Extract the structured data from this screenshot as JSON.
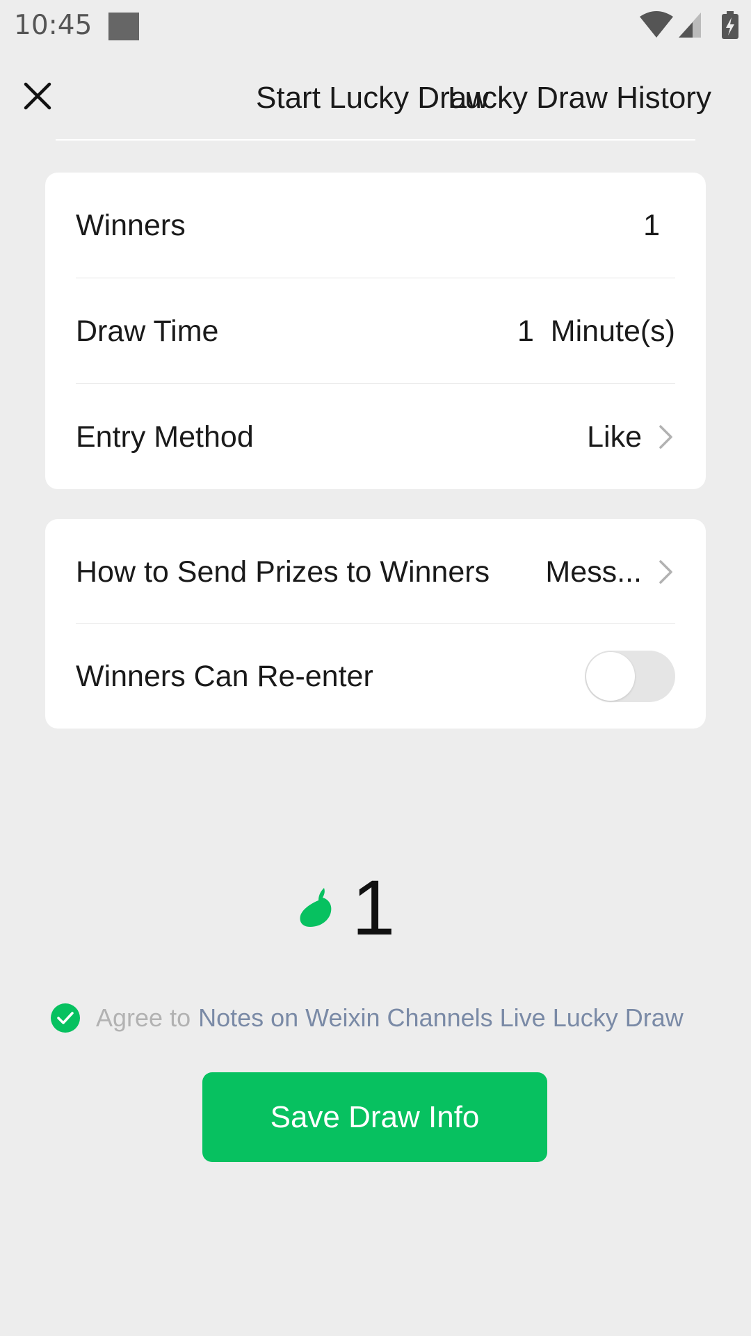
{
  "status_bar": {
    "time": "10:45",
    "icons": [
      "notification-square-icon",
      "wifi-icon",
      "signal-icon",
      "battery-charging-icon"
    ]
  },
  "header": {
    "close_icon": "close-icon",
    "tab_start": "Start Lucky Draw",
    "tab_history": "Lucky Draw History"
  },
  "settings": {
    "winners_label": "Winners",
    "winners_value": "1",
    "draw_time_label": "Draw Time",
    "draw_time_value": "1  Minute(s)",
    "entry_method_label": "Entry Method",
    "entry_method_value": "Like",
    "prizes_label": "How to Send Prizes to Winners",
    "prizes_value": "Mess...",
    "reenter_label": "Winners Can Re-enter",
    "reenter_enabled": false
  },
  "like_counter": {
    "count": "1",
    "icon": "like-icon"
  },
  "agreement": {
    "prefix": "Agree to",
    "link": "Notes on Weixin Channels Live Lucky Draw",
    "checked": true
  },
  "save_button": {
    "label": "Save Draw Info"
  },
  "colors": {
    "accent": "#07c160",
    "background": "#ededed",
    "link": "#7a8aa6"
  }
}
